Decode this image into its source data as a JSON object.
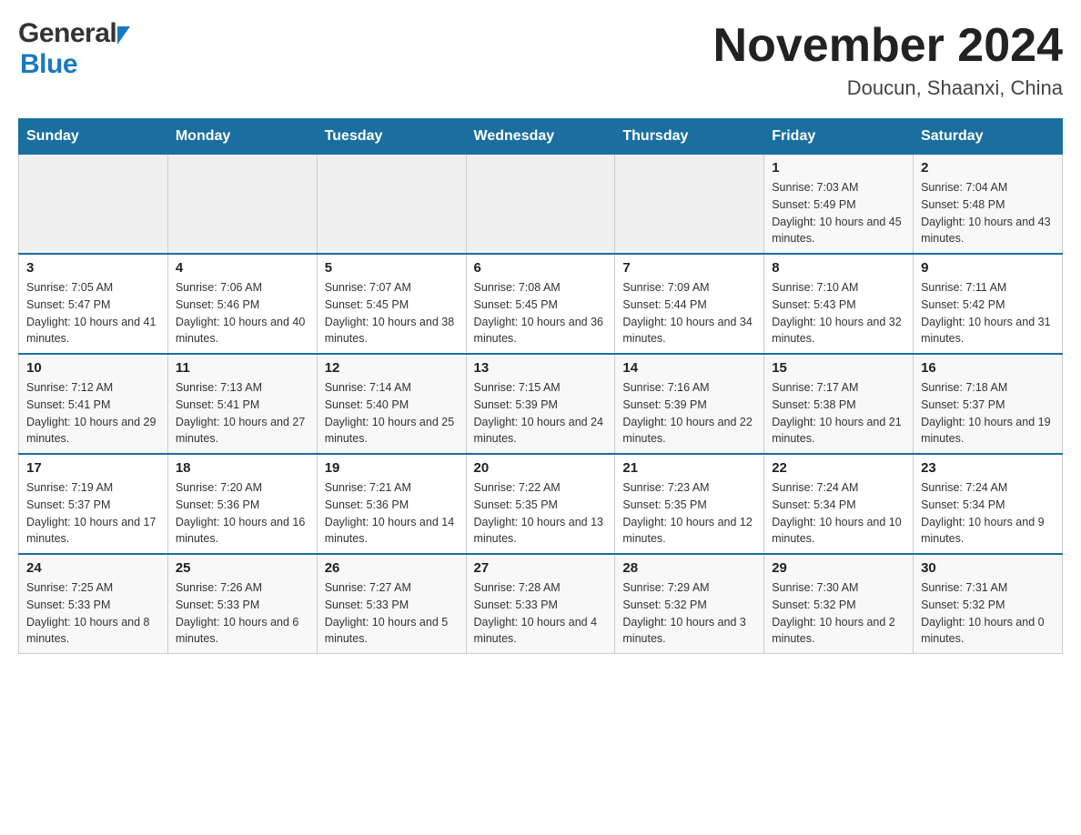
{
  "header": {
    "title": "November 2024",
    "subtitle": "Doucun, Shaanxi, China",
    "logo_general": "General",
    "logo_blue": "Blue"
  },
  "days_of_week": [
    "Sunday",
    "Monday",
    "Tuesday",
    "Wednesday",
    "Thursday",
    "Friday",
    "Saturday"
  ],
  "weeks": [
    [
      {
        "day": "",
        "info": ""
      },
      {
        "day": "",
        "info": ""
      },
      {
        "day": "",
        "info": ""
      },
      {
        "day": "",
        "info": ""
      },
      {
        "day": "",
        "info": ""
      },
      {
        "day": "1",
        "info": "Sunrise: 7:03 AM\nSunset: 5:49 PM\nDaylight: 10 hours and 45 minutes."
      },
      {
        "day": "2",
        "info": "Sunrise: 7:04 AM\nSunset: 5:48 PM\nDaylight: 10 hours and 43 minutes."
      }
    ],
    [
      {
        "day": "3",
        "info": "Sunrise: 7:05 AM\nSunset: 5:47 PM\nDaylight: 10 hours and 41 minutes."
      },
      {
        "day": "4",
        "info": "Sunrise: 7:06 AM\nSunset: 5:46 PM\nDaylight: 10 hours and 40 minutes."
      },
      {
        "day": "5",
        "info": "Sunrise: 7:07 AM\nSunset: 5:45 PM\nDaylight: 10 hours and 38 minutes."
      },
      {
        "day": "6",
        "info": "Sunrise: 7:08 AM\nSunset: 5:45 PM\nDaylight: 10 hours and 36 minutes."
      },
      {
        "day": "7",
        "info": "Sunrise: 7:09 AM\nSunset: 5:44 PM\nDaylight: 10 hours and 34 minutes."
      },
      {
        "day": "8",
        "info": "Sunrise: 7:10 AM\nSunset: 5:43 PM\nDaylight: 10 hours and 32 minutes."
      },
      {
        "day": "9",
        "info": "Sunrise: 7:11 AM\nSunset: 5:42 PM\nDaylight: 10 hours and 31 minutes."
      }
    ],
    [
      {
        "day": "10",
        "info": "Sunrise: 7:12 AM\nSunset: 5:41 PM\nDaylight: 10 hours and 29 minutes."
      },
      {
        "day": "11",
        "info": "Sunrise: 7:13 AM\nSunset: 5:41 PM\nDaylight: 10 hours and 27 minutes."
      },
      {
        "day": "12",
        "info": "Sunrise: 7:14 AM\nSunset: 5:40 PM\nDaylight: 10 hours and 25 minutes."
      },
      {
        "day": "13",
        "info": "Sunrise: 7:15 AM\nSunset: 5:39 PM\nDaylight: 10 hours and 24 minutes."
      },
      {
        "day": "14",
        "info": "Sunrise: 7:16 AM\nSunset: 5:39 PM\nDaylight: 10 hours and 22 minutes."
      },
      {
        "day": "15",
        "info": "Sunrise: 7:17 AM\nSunset: 5:38 PM\nDaylight: 10 hours and 21 minutes."
      },
      {
        "day": "16",
        "info": "Sunrise: 7:18 AM\nSunset: 5:37 PM\nDaylight: 10 hours and 19 minutes."
      }
    ],
    [
      {
        "day": "17",
        "info": "Sunrise: 7:19 AM\nSunset: 5:37 PM\nDaylight: 10 hours and 17 minutes."
      },
      {
        "day": "18",
        "info": "Sunrise: 7:20 AM\nSunset: 5:36 PM\nDaylight: 10 hours and 16 minutes."
      },
      {
        "day": "19",
        "info": "Sunrise: 7:21 AM\nSunset: 5:36 PM\nDaylight: 10 hours and 14 minutes."
      },
      {
        "day": "20",
        "info": "Sunrise: 7:22 AM\nSunset: 5:35 PM\nDaylight: 10 hours and 13 minutes."
      },
      {
        "day": "21",
        "info": "Sunrise: 7:23 AM\nSunset: 5:35 PM\nDaylight: 10 hours and 12 minutes."
      },
      {
        "day": "22",
        "info": "Sunrise: 7:24 AM\nSunset: 5:34 PM\nDaylight: 10 hours and 10 minutes."
      },
      {
        "day": "23",
        "info": "Sunrise: 7:24 AM\nSunset: 5:34 PM\nDaylight: 10 hours and 9 minutes."
      }
    ],
    [
      {
        "day": "24",
        "info": "Sunrise: 7:25 AM\nSunset: 5:33 PM\nDaylight: 10 hours and 8 minutes."
      },
      {
        "day": "25",
        "info": "Sunrise: 7:26 AM\nSunset: 5:33 PM\nDaylight: 10 hours and 6 minutes."
      },
      {
        "day": "26",
        "info": "Sunrise: 7:27 AM\nSunset: 5:33 PM\nDaylight: 10 hours and 5 minutes."
      },
      {
        "day": "27",
        "info": "Sunrise: 7:28 AM\nSunset: 5:33 PM\nDaylight: 10 hours and 4 minutes."
      },
      {
        "day": "28",
        "info": "Sunrise: 7:29 AM\nSunset: 5:32 PM\nDaylight: 10 hours and 3 minutes."
      },
      {
        "day": "29",
        "info": "Sunrise: 7:30 AM\nSunset: 5:32 PM\nDaylight: 10 hours and 2 minutes."
      },
      {
        "day": "30",
        "info": "Sunrise: 7:31 AM\nSunset: 5:32 PM\nDaylight: 10 hours and 0 minutes."
      }
    ]
  ]
}
